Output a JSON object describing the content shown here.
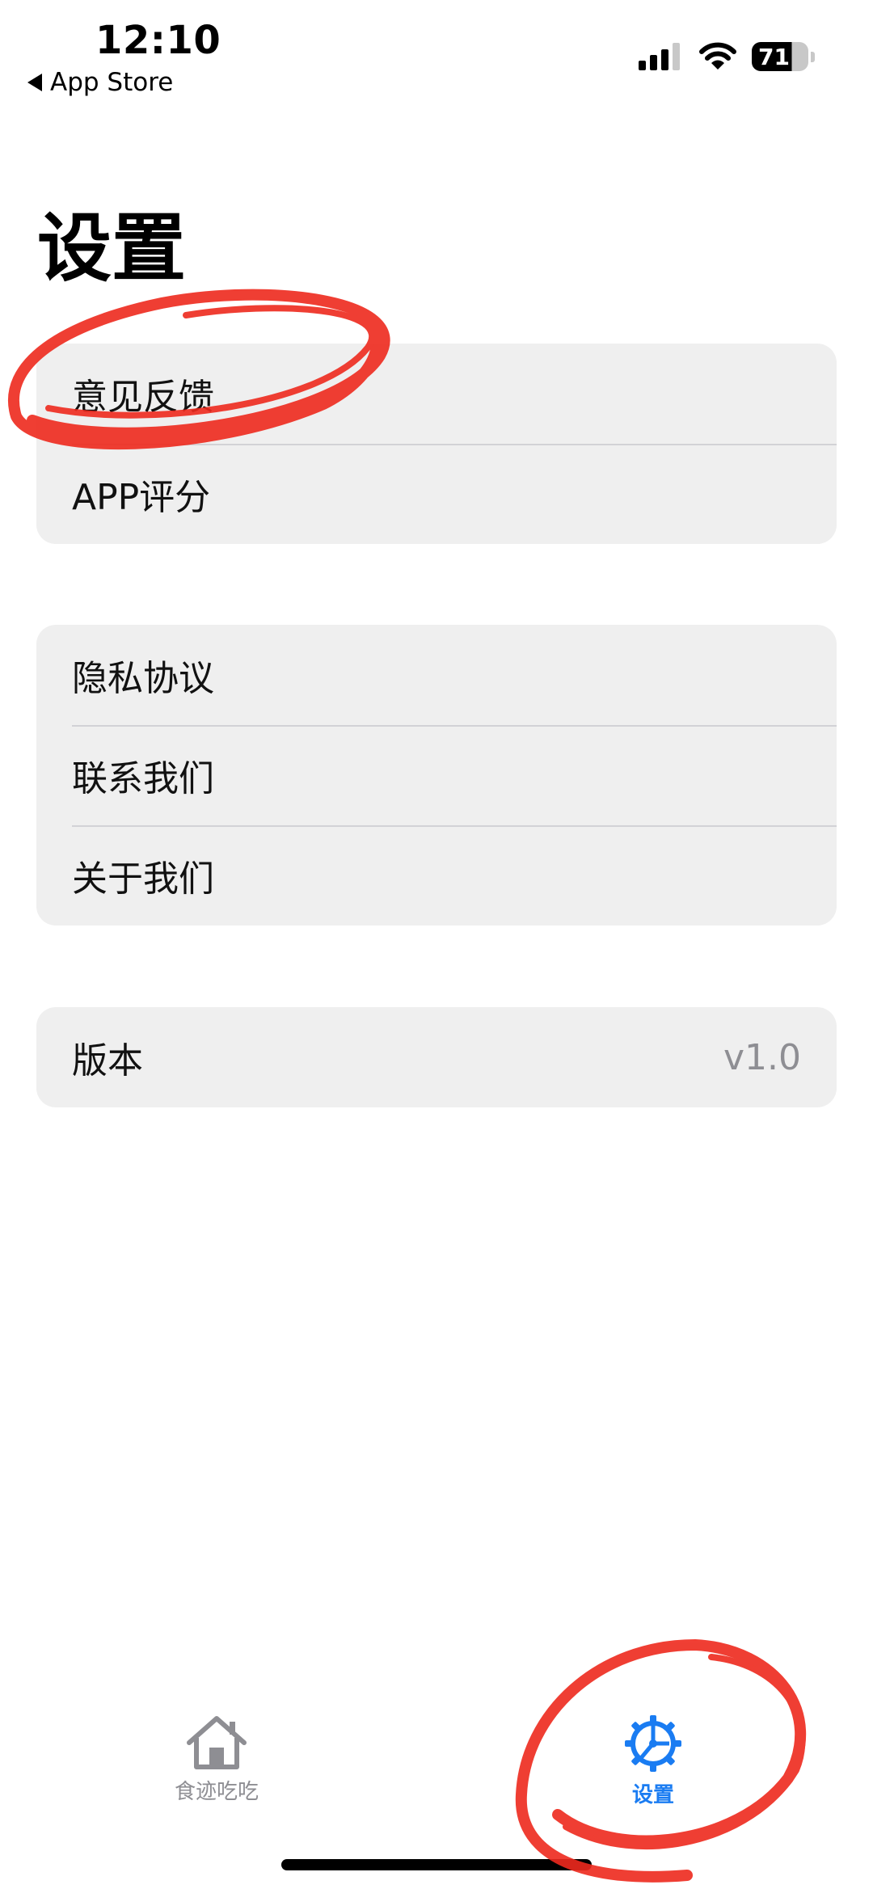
{
  "status_bar": {
    "time": "12:10",
    "back_label": "App Store",
    "battery_percent": "71"
  },
  "page": {
    "title": "设置"
  },
  "groups": [
    {
      "rows": [
        {
          "label": "意见反馈"
        },
        {
          "label": "APP评分"
        }
      ]
    },
    {
      "rows": [
        {
          "label": "隐私协议"
        },
        {
          "label": "联系我们"
        },
        {
          "label": "关于我们"
        }
      ]
    },
    {
      "rows": [
        {
          "label": "版本",
          "value": "v1.0"
        }
      ]
    }
  ],
  "tab_bar": {
    "tabs": [
      {
        "label": "食迹吃吃",
        "icon": "house-icon",
        "selected": false
      },
      {
        "label": "设置",
        "icon": "gear-icon",
        "selected": true
      }
    ]
  },
  "colors": {
    "accent": "#1a7cf2",
    "annotation": "#ee2a1e",
    "group_background": "#efefef",
    "secondary_text": "#8e8e93"
  }
}
